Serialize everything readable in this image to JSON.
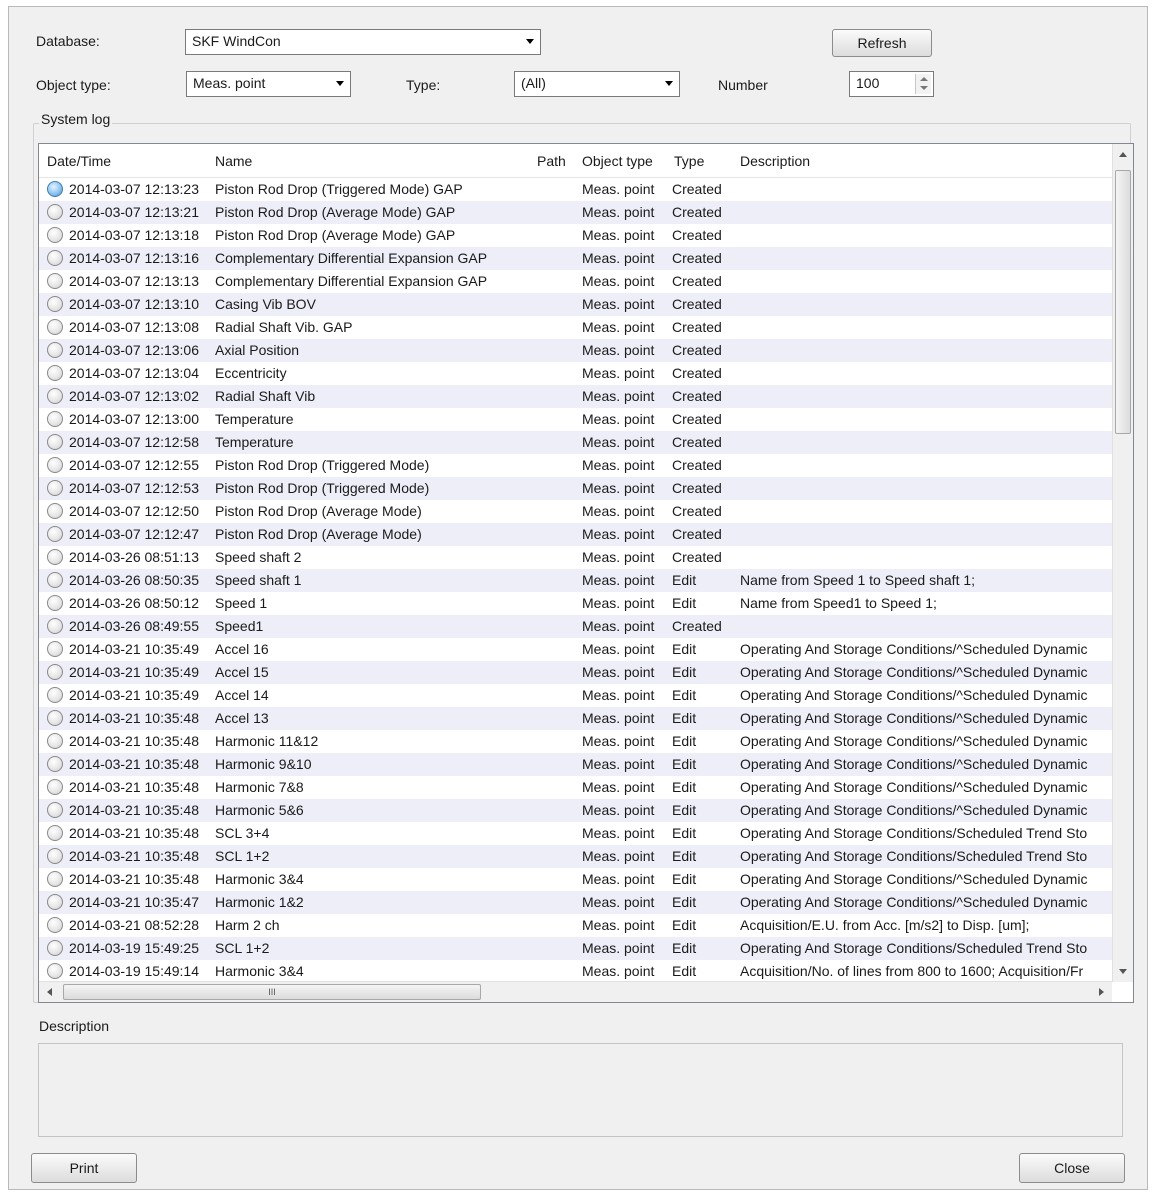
{
  "form": {
    "database_label": "Database:",
    "database_value": "SKF WindCon",
    "refresh_label": "Refresh",
    "object_type_label": "Object type:",
    "object_type_value": "Meas. point",
    "type_label": "Type:",
    "type_value": "(All)",
    "number_label": "Number",
    "number_value": "100"
  },
  "system_log": {
    "group_label": "System log",
    "columns": {
      "datetime": "Date/Time",
      "name": "Name",
      "path": "Path",
      "object_type": "Object type",
      "type": "Type",
      "description": "Description"
    },
    "rows": [
      {
        "datetime": "2014-03-07 12:13:23",
        "name": "Piston Rod Drop (Triggered Mode) GAP",
        "object_type": "Meas. point",
        "type": "Created",
        "description": ""
      },
      {
        "datetime": "2014-03-07 12:13:21",
        "name": "Piston Rod Drop (Average Mode) GAP",
        "object_type": "Meas. point",
        "type": "Created",
        "description": ""
      },
      {
        "datetime": "2014-03-07 12:13:18",
        "name": "Piston Rod Drop (Average Mode) GAP",
        "object_type": "Meas. point",
        "type": "Created",
        "description": ""
      },
      {
        "datetime": "2014-03-07 12:13:16",
        "name": "Complementary Differential Expansion GAP",
        "object_type": "Meas. point",
        "type": "Created",
        "description": ""
      },
      {
        "datetime": "2014-03-07 12:13:13",
        "name": "Complementary Differential Expansion GAP",
        "object_type": "Meas. point",
        "type": "Created",
        "description": ""
      },
      {
        "datetime": "2014-03-07 12:13:10",
        "name": "Casing Vib BOV",
        "object_type": "Meas. point",
        "type": "Created",
        "description": ""
      },
      {
        "datetime": "2014-03-07 12:13:08",
        "name": "Radial Shaft Vib. GAP",
        "object_type": "Meas. point",
        "type": "Created",
        "description": ""
      },
      {
        "datetime": "2014-03-07 12:13:06",
        "name": "Axial Position",
        "object_type": "Meas. point",
        "type": "Created",
        "description": ""
      },
      {
        "datetime": "2014-03-07 12:13:04",
        "name": "Eccentricity",
        "object_type": "Meas. point",
        "type": "Created",
        "description": ""
      },
      {
        "datetime": "2014-03-07 12:13:02",
        "name": "Radial Shaft Vib",
        "object_type": "Meas. point",
        "type": "Created",
        "description": ""
      },
      {
        "datetime": "2014-03-07 12:13:00",
        "name": "Temperature",
        "object_type": "Meas. point",
        "type": "Created",
        "description": ""
      },
      {
        "datetime": "2014-03-07 12:12:58",
        "name": "Temperature",
        "object_type": "Meas. point",
        "type": "Created",
        "description": ""
      },
      {
        "datetime": "2014-03-07 12:12:55",
        "name": "Piston Rod Drop (Triggered Mode)",
        "object_type": "Meas. point",
        "type": "Created",
        "description": ""
      },
      {
        "datetime": "2014-03-07 12:12:53",
        "name": "Piston Rod Drop (Triggered Mode)",
        "object_type": "Meas. point",
        "type": "Created",
        "description": ""
      },
      {
        "datetime": "2014-03-07 12:12:50",
        "name": "Piston Rod Drop (Average Mode)",
        "object_type": "Meas. point",
        "type": "Created",
        "description": ""
      },
      {
        "datetime": "2014-03-07 12:12:47",
        "name": "Piston Rod Drop (Average Mode)",
        "object_type": "Meas. point",
        "type": "Created",
        "description": ""
      },
      {
        "datetime": "2014-03-26 08:51:13",
        "name": "Speed shaft 2",
        "object_type": "Meas. point",
        "type": "Created",
        "description": ""
      },
      {
        "datetime": "2014-03-26 08:50:35",
        "name": "Speed shaft 1",
        "object_type": "Meas. point",
        "type": "Edit",
        "description": "Name from Speed 1 to Speed shaft 1;"
      },
      {
        "datetime": "2014-03-26 08:50:12",
        "name": "Speed 1",
        "object_type": "Meas. point",
        "type": "Edit",
        "description": "Name from Speed1 to Speed 1;"
      },
      {
        "datetime": "2014-03-26 08:49:55",
        "name": "Speed1",
        "object_type": "Meas. point",
        "type": "Created",
        "description": ""
      },
      {
        "datetime": "2014-03-21 10:35:49",
        "name": "Accel 16",
        "object_type": "Meas. point",
        "type": "Edit",
        "description": "Operating And Storage Conditions/^Scheduled Dynamic"
      },
      {
        "datetime": "2014-03-21 10:35:49",
        "name": "Accel 15",
        "object_type": "Meas. point",
        "type": "Edit",
        "description": "Operating And Storage Conditions/^Scheduled Dynamic"
      },
      {
        "datetime": "2014-03-21 10:35:49",
        "name": "Accel 14",
        "object_type": "Meas. point",
        "type": "Edit",
        "description": "Operating And Storage Conditions/^Scheduled Dynamic"
      },
      {
        "datetime": "2014-03-21 10:35:48",
        "name": "Accel 13",
        "object_type": "Meas. point",
        "type": "Edit",
        "description": "Operating And Storage Conditions/^Scheduled Dynamic"
      },
      {
        "datetime": "2014-03-21 10:35:48",
        "name": "Harmonic 11&12",
        "object_type": "Meas. point",
        "type": "Edit",
        "description": "Operating And Storage Conditions/^Scheduled Dynamic"
      },
      {
        "datetime": "2014-03-21 10:35:48",
        "name": "Harmonic 9&10",
        "object_type": "Meas. point",
        "type": "Edit",
        "description": "Operating And Storage Conditions/^Scheduled Dynamic"
      },
      {
        "datetime": "2014-03-21 10:35:48",
        "name": "Harmonic 7&8",
        "object_type": "Meas. point",
        "type": "Edit",
        "description": "Operating And Storage Conditions/^Scheduled Dynamic"
      },
      {
        "datetime": "2014-03-21 10:35:48",
        "name": "Harmonic 5&6",
        "object_type": "Meas. point",
        "type": "Edit",
        "description": "Operating And Storage Conditions/^Scheduled Dynamic"
      },
      {
        "datetime": "2014-03-21 10:35:48",
        "name": "SCL 3+4",
        "object_type": "Meas. point",
        "type": "Edit",
        "description": "Operating And Storage Conditions/Scheduled Trend Sto"
      },
      {
        "datetime": "2014-03-21 10:35:48",
        "name": "SCL 1+2",
        "object_type": "Meas. point",
        "type": "Edit",
        "description": "Operating And Storage Conditions/Scheduled Trend Sto"
      },
      {
        "datetime": "2014-03-21 10:35:48",
        "name": "Harmonic 3&4",
        "object_type": "Meas. point",
        "type": "Edit",
        "description": "Operating And Storage Conditions/^Scheduled Dynamic"
      },
      {
        "datetime": "2014-03-21 10:35:47",
        "name": "Harmonic 1&2",
        "object_type": "Meas. point",
        "type": "Edit",
        "description": "Operating And Storage Conditions/^Scheduled Dynamic"
      },
      {
        "datetime": "2014-03-21 08:52:28",
        "name": "Harm 2 ch",
        "object_type": "Meas. point",
        "type": "Edit",
        "description": "Acquisition/E.U. from Acc. [m/s2] to Disp. [um];"
      },
      {
        "datetime": "2014-03-19 15:49:25",
        "name": "SCL 1+2",
        "object_type": "Meas. point",
        "type": "Edit",
        "description": "Operating And Storage Conditions/Scheduled Trend Sto"
      },
      {
        "datetime": "2014-03-19 15:49:14",
        "name": "Harmonic 3&4",
        "object_type": "Meas. point",
        "type": "Edit",
        "description": "Acquisition/No. of lines from 800 to 1600; Acquisition/Fr"
      }
    ],
    "hscroll_thumb_text": "III"
  },
  "description_panel": {
    "label": "Description",
    "value": ""
  },
  "footer": {
    "print_label": "Print",
    "close_label": "Close"
  },
  "colors": {
    "window_bg": "#f0f0f0",
    "alt_row": "#eeeef8",
    "selected_radio": "#4a8fca"
  },
  "icons": {
    "row_marker": "radio-circle-icon",
    "combo_arrow": "chevron-down-icon",
    "spin": "spinner-arrows-icon"
  }
}
